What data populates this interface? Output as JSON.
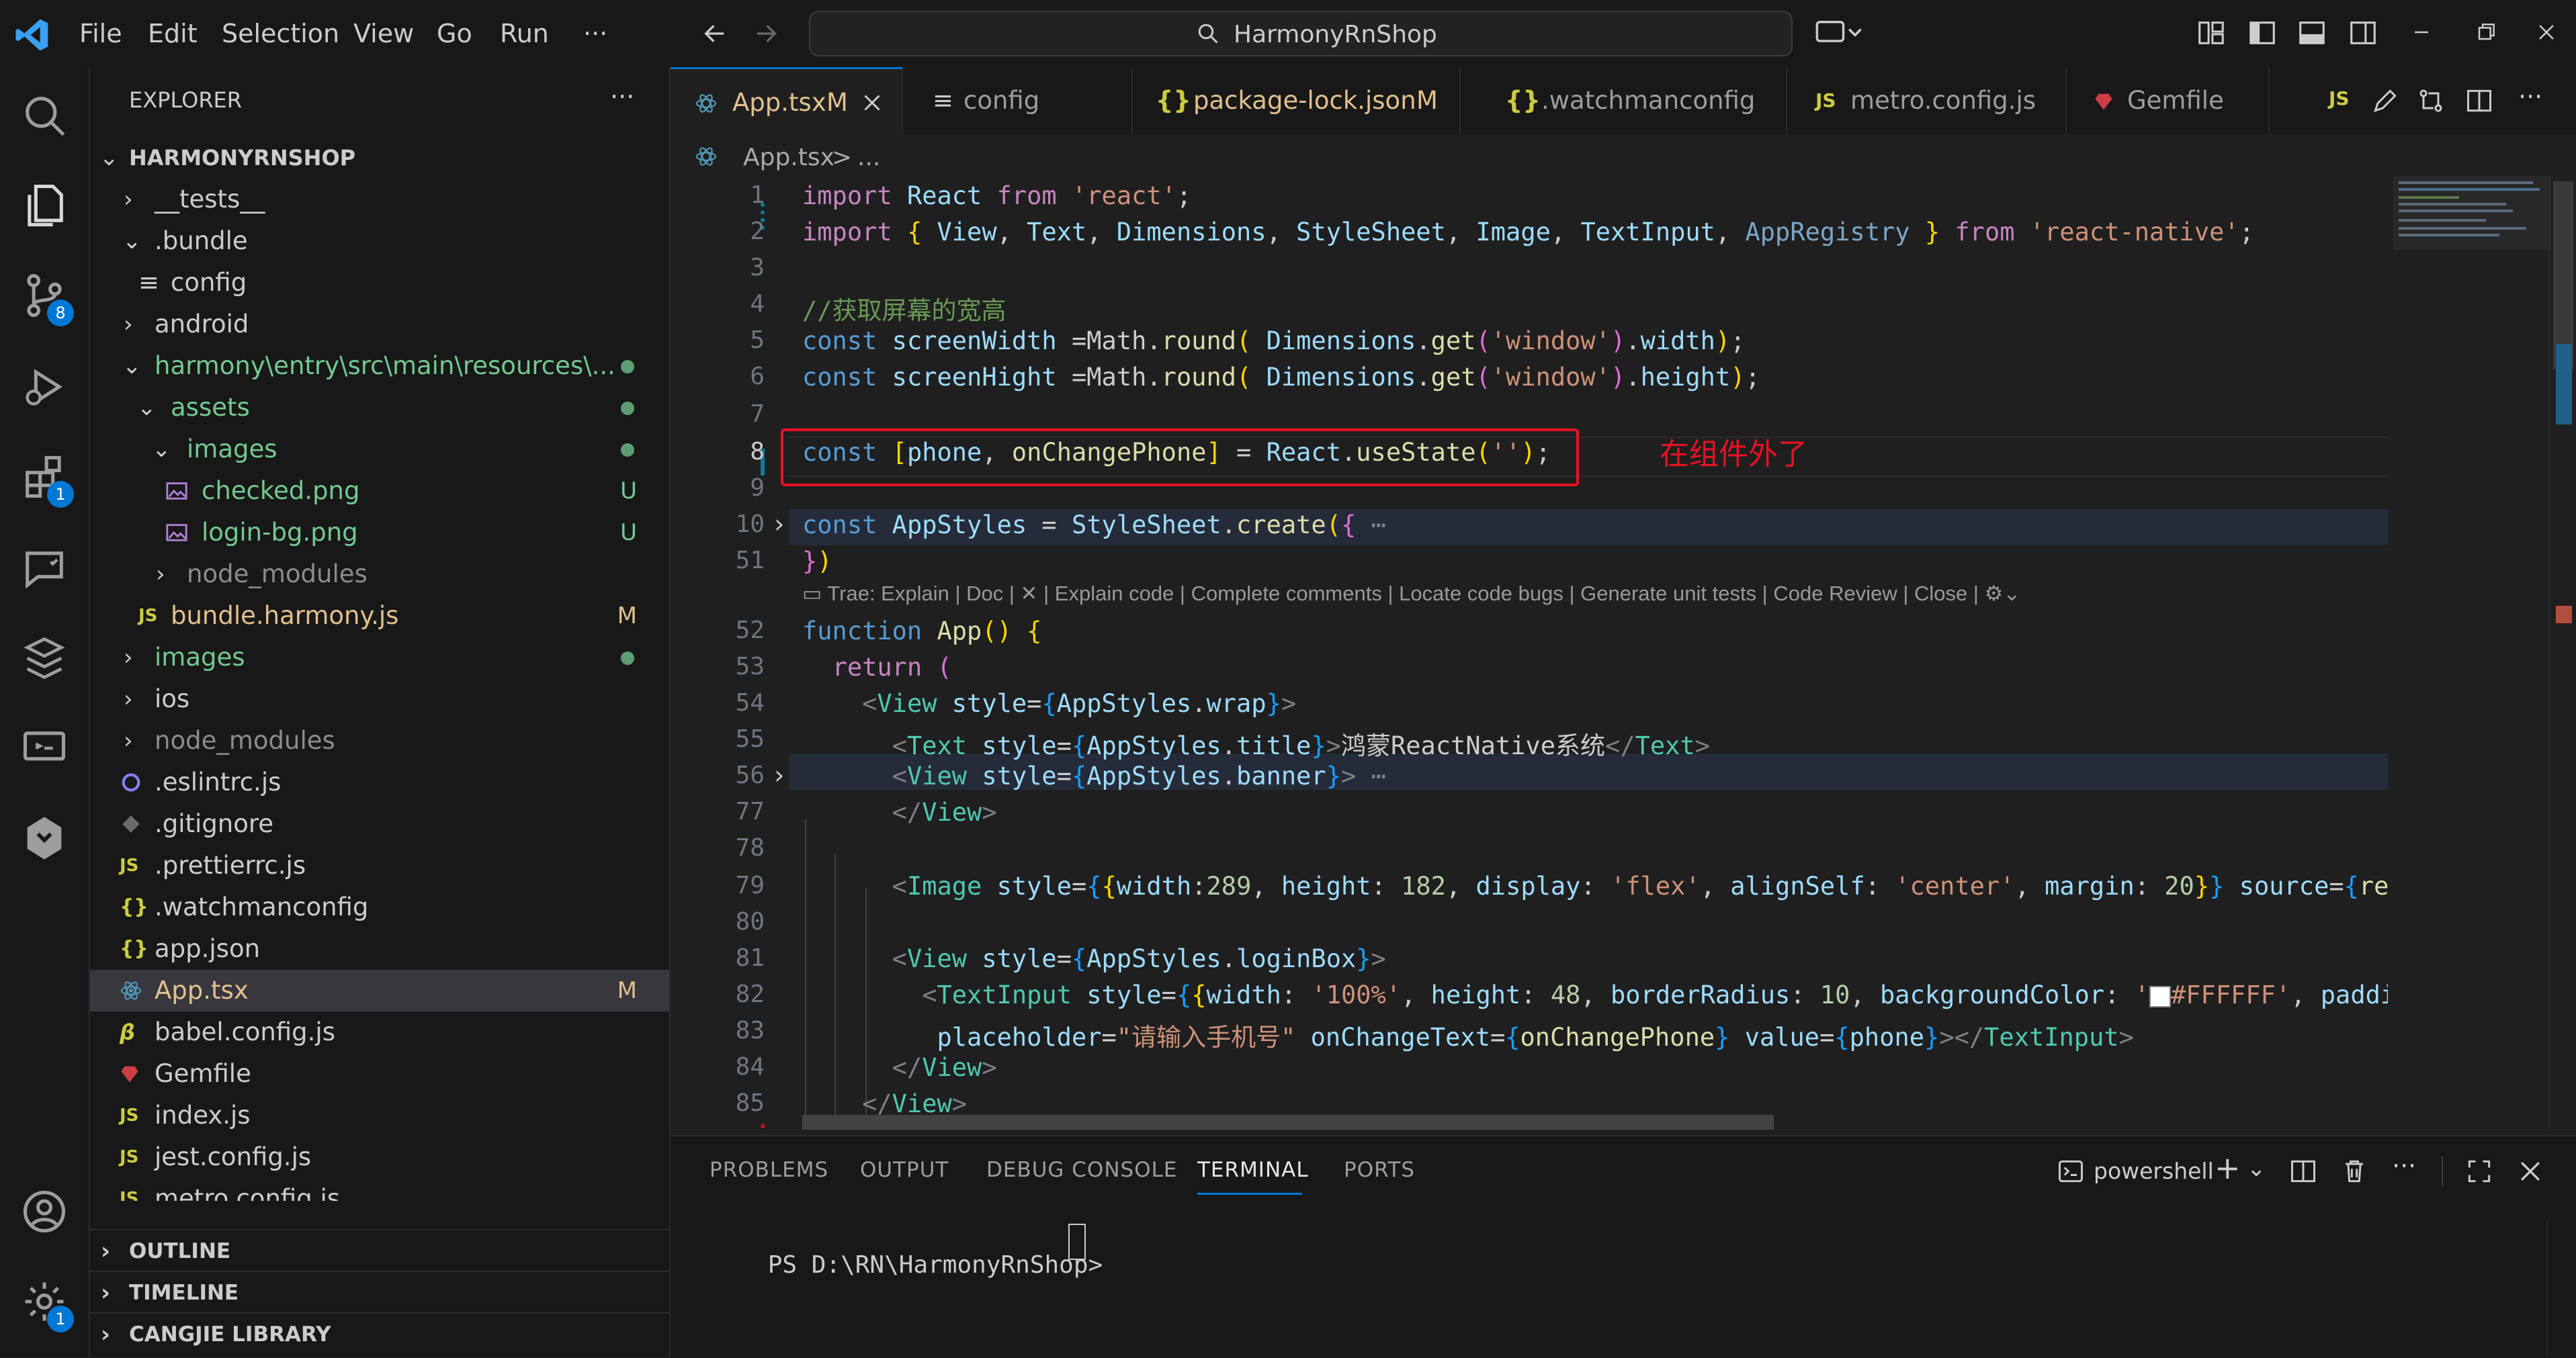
{
  "titlebar": {
    "menus": [
      "File",
      "Edit",
      "Selection",
      "View",
      "Go",
      "Run",
      "···"
    ],
    "search_text": "HarmonyRnShop"
  },
  "activity": {
    "scm_badge": "8",
    "extensions_badge": "1",
    "settings_badge": "1"
  },
  "sidebar": {
    "title": "EXPLORER",
    "more": "···",
    "root": "HARMONYRNSHOP",
    "items": [
      {
        "label": "__tests__"
      },
      {
        "label": ".bundle"
      },
      {
        "label": "config"
      },
      {
        "label": "android"
      },
      {
        "label": "harmony\\entry\\src\\main\\resources\\..."
      },
      {
        "label": "assets"
      },
      {
        "label": "images"
      },
      {
        "label": "checked.png",
        "deco": "U"
      },
      {
        "label": "login-bg.png",
        "deco": "U"
      },
      {
        "label": "node_modules"
      },
      {
        "label": "bundle.harmony.js",
        "deco": "M"
      },
      {
        "label": "images"
      },
      {
        "label": "ios"
      },
      {
        "label": "node_modules"
      },
      {
        "label": ".eslintrc.js"
      },
      {
        "label": ".gitignore"
      },
      {
        "label": ".prettierrc.js"
      },
      {
        "label": ".watchmanconfig"
      },
      {
        "label": "app.json"
      },
      {
        "label": "App.tsx",
        "deco": "M"
      },
      {
        "label": "babel.config.js"
      },
      {
        "label": "Gemfile"
      },
      {
        "label": "index.js"
      },
      {
        "label": "jest.config.js"
      },
      {
        "label": "metro.config.js"
      }
    ],
    "sections": [
      "OUTLINE",
      "TIMELINE",
      "CANGJIE LIBRARY"
    ]
  },
  "tabs": [
    {
      "label": "App.tsx",
      "mark": "M"
    },
    {
      "label": "config",
      "mark": ""
    },
    {
      "label": "package-lock.json",
      "mark": "M"
    },
    {
      "label": ".watchmanconfig",
      "mark": ""
    },
    {
      "label": "metro.config.js",
      "mark": ""
    },
    {
      "label": "Gemfile",
      "mark": ""
    }
  ],
  "breadcrumb": {
    "file": "App.tsx",
    "sep": ">",
    "rest": "..."
  },
  "editor": {
    "line_numbers": [
      "1",
      "2",
      "3",
      "4",
      "5",
      "6",
      "7",
      "8",
      "9",
      "10",
      "51",
      "52",
      "53",
      "54",
      "55",
      "56",
      "77",
      "78",
      "79",
      "80",
      "81",
      "82",
      "83",
      "84",
      "85"
    ],
    "annotation": "在组件外了",
    "codelens": "Trae: Explain | Doc | ✕ | Explain code | Complete comments | Locate code bugs | Generate unit tests | Code Review | Close |",
    "comment_line": "//获取屏幕的宽高",
    "title_text": "鸿蒙ReactNative系统",
    "placeholder_text": "请输入手机号",
    "color_swatch": "#FFFFFF"
  },
  "panel": {
    "tabs": [
      "PROBLEMS",
      "OUTPUT",
      "DEBUG CONSOLE",
      "TERMINAL",
      "PORTS"
    ],
    "active_tab": "TERMINAL",
    "shell": "powershell",
    "prompt": "PS D:\\RN\\HarmonyRnShop>"
  },
  "colors": {
    "accent": "#0078d4",
    "annotation_red": "#e81123",
    "modified": "#e2c08d",
    "untracked": "#73c991"
  }
}
